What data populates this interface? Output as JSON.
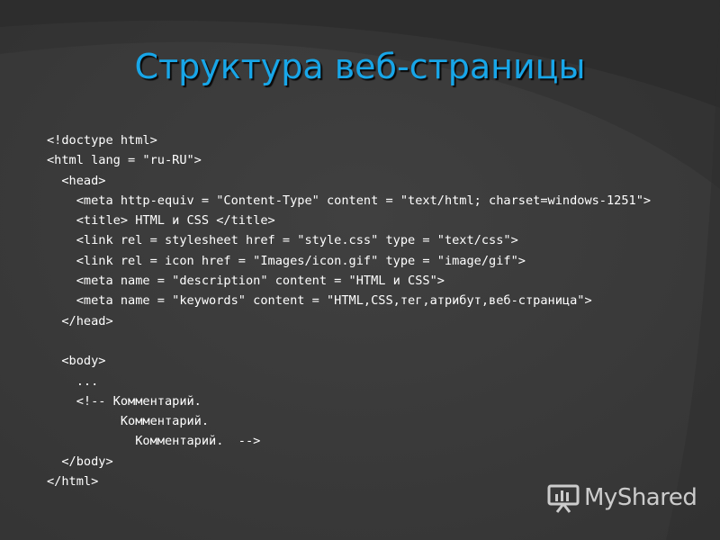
{
  "slide": {
    "title": "Структура веб-страницы",
    "code_lines": [
      "<!doctype html>",
      "<html lang = \"ru-RU\">",
      "  <head>",
      "    <meta http-equiv = \"Content-Type\" content = \"text/html; charset=windows-1251\">",
      "    <title> HTML и CSS </title>",
      "    <link rel = stylesheet href = \"style.css\" type = \"text/css\">",
      "    <link rel = icon href = \"Images/icon.gif\" type = \"image/gif\">",
      "    <meta name = \"description\" content = \"HTML и CSS\">",
      "    <meta name = \"keywords\" content = \"HTML,CSS,тег,атрибут,веб-страница\">",
      "  </head>",
      "",
      "  <body>",
      "    ...",
      "    <!-- Комментарий.",
      "          Комментарий.",
      "            Комментарий.  -->",
      "  </body>",
      "</html>"
    ]
  },
  "watermark": {
    "text": "MyShared",
    "icon": "presentation-board-icon"
  },
  "colors": {
    "background": "#3b3b3b",
    "title": "#18a6e8",
    "code_text": "#ffffff"
  }
}
